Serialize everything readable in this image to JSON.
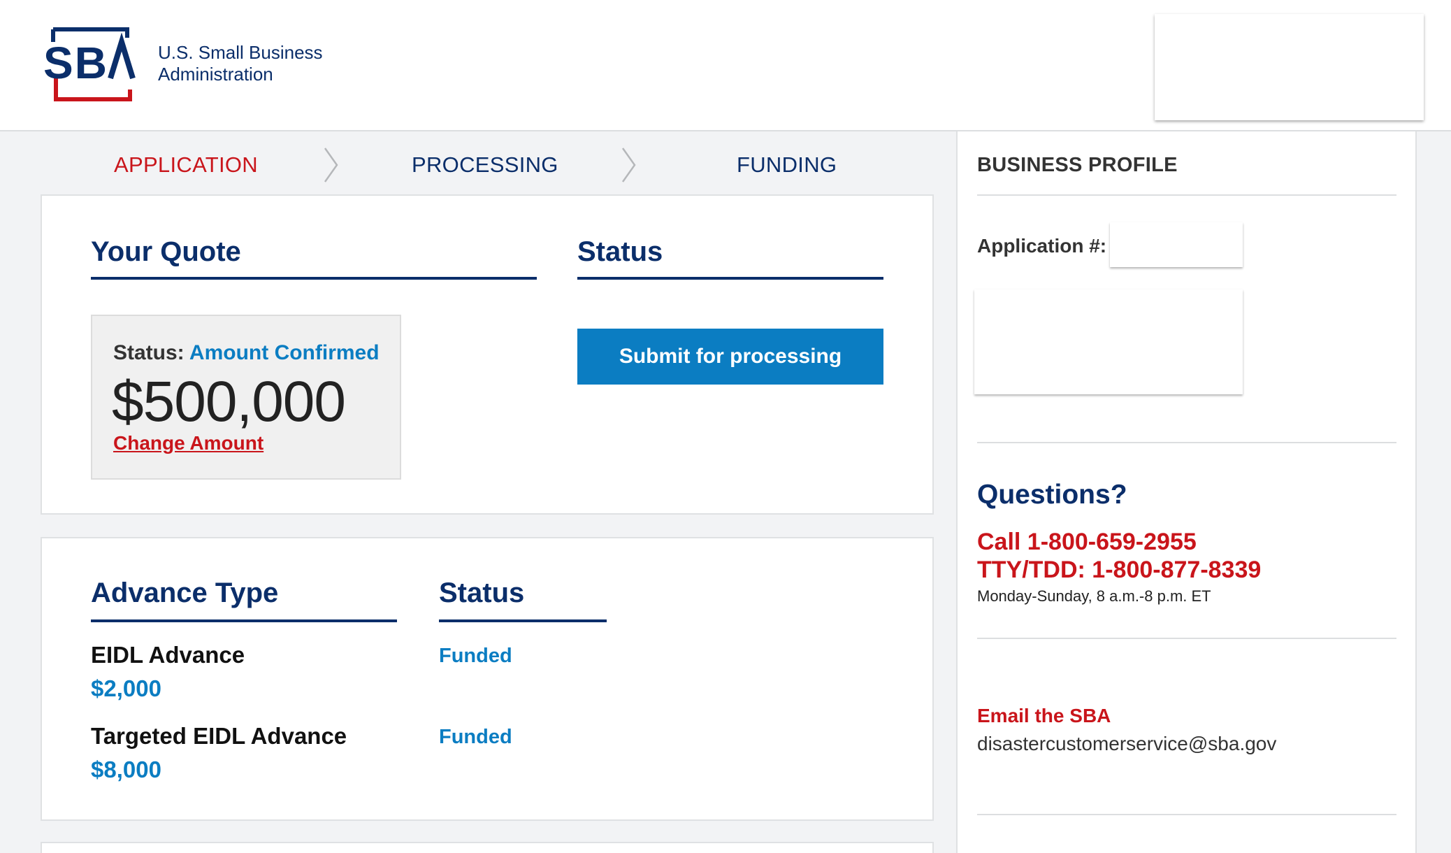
{
  "header": {
    "logo_text": "SBA",
    "org_line1": "U.S. Small Business",
    "org_line2": "Administration",
    "colors": {
      "navy": "#0b2e6a",
      "red": "#c9151b"
    }
  },
  "steps": [
    {
      "label": "APPLICATION",
      "active": true
    },
    {
      "label": "PROCESSING",
      "active": false
    },
    {
      "label": "FUNDING",
      "active": false
    }
  ],
  "quote": {
    "heading": "Your Quote",
    "status_heading": "Status",
    "status_label": "Status:",
    "status_value": "Amount Confirmed",
    "amount": "$500,000",
    "change_link": "Change Amount",
    "submit_button": "Submit for processing"
  },
  "advance": {
    "heading": "Advance Type",
    "status_heading": "Status",
    "items": [
      {
        "name": "EIDL Advance",
        "amount": "$2,000",
        "status": "Funded"
      },
      {
        "name": "Targeted EIDL Advance",
        "amount": "$8,000",
        "status": "Funded"
      }
    ]
  },
  "sidebar": {
    "title": "BUSINESS PROFILE",
    "app_label": "Application #:",
    "questions": "Questions?",
    "call": "Call 1-800-659-2955",
    "tty": "TTY/TDD: 1-800-877-8339",
    "hours": "Monday-Sunday, 8 a.m.-8 p.m. ET",
    "email_label": "Email the SBA",
    "email": "disastercustomerservice@sba.gov"
  },
  "colors": {
    "accent_blue": "#0b7dc2",
    "navy": "#0b2e6a",
    "red": "#c9151b",
    "bg": "#f2f3f5"
  }
}
